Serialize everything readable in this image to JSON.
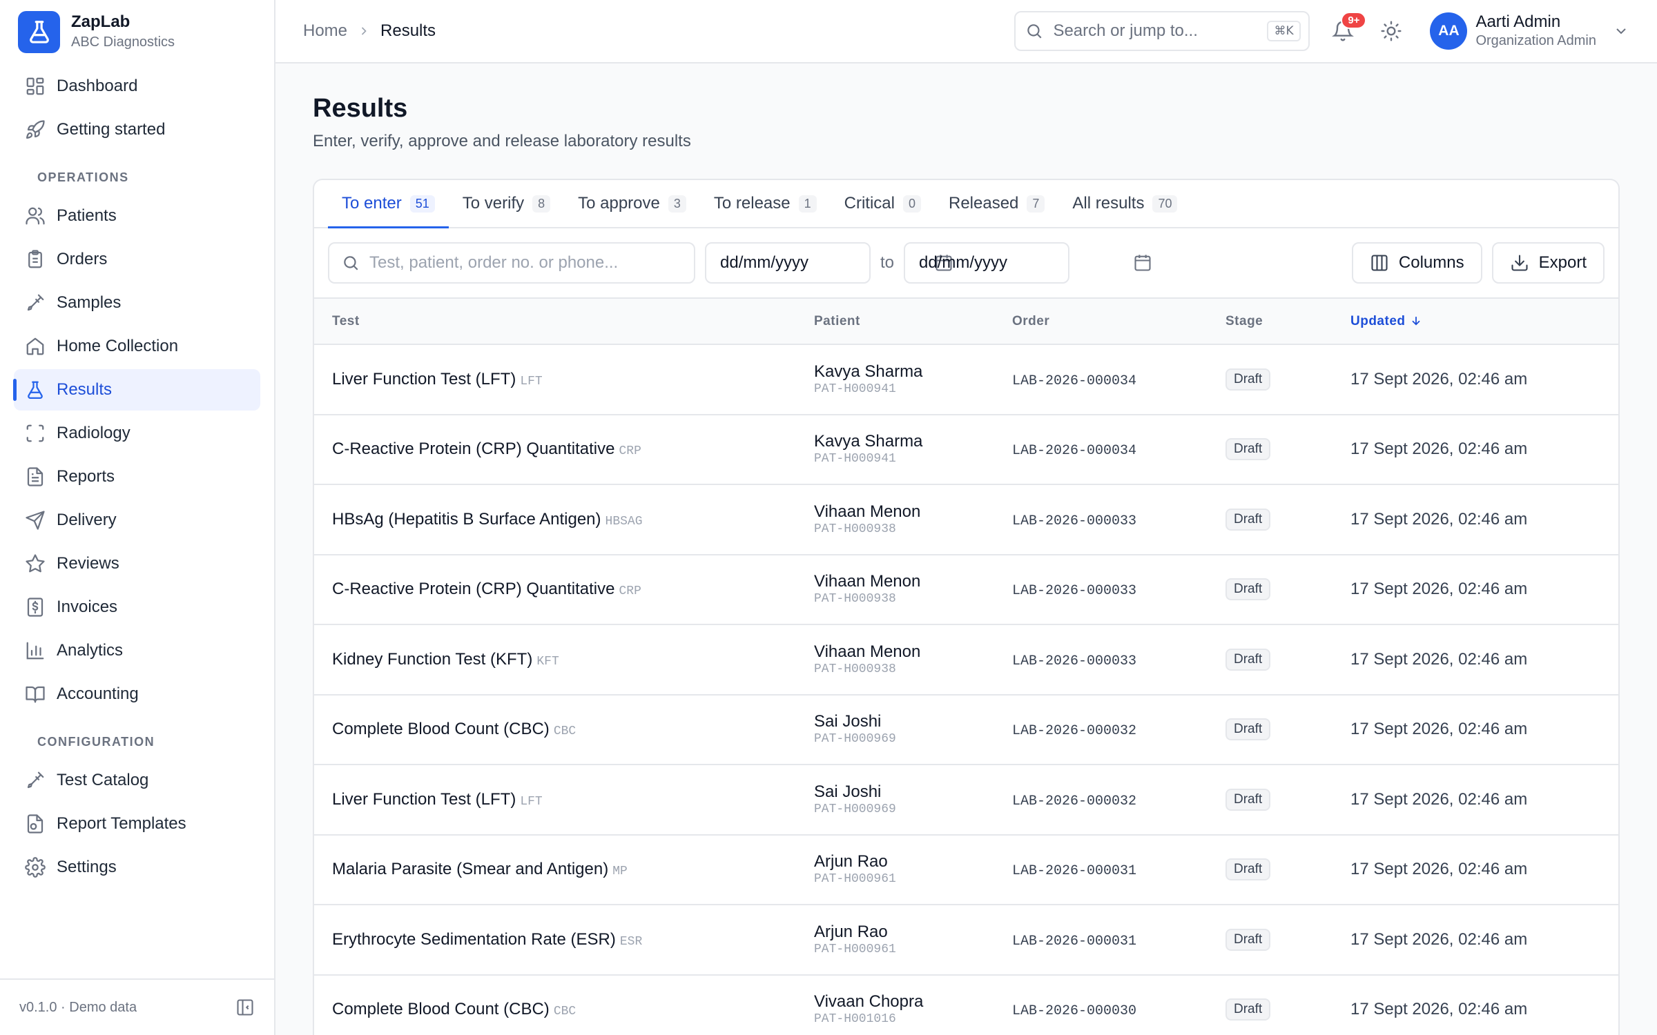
{
  "brand": {
    "name": "ZapLab",
    "org": "ABC Diagnostics"
  },
  "sidebar": {
    "top_items": [
      {
        "label": "Dashboard",
        "icon": "dashboard-icon"
      },
      {
        "label": "Getting started",
        "icon": "rocket-icon"
      }
    ],
    "operations_label": "OPERATIONS",
    "operations_items": [
      {
        "label": "Patients",
        "icon": "users-icon"
      },
      {
        "label": "Orders",
        "icon": "clipboard-icon"
      },
      {
        "label": "Samples",
        "icon": "pipette-icon"
      },
      {
        "label": "Home Collection",
        "icon": "home-icon"
      },
      {
        "label": "Results",
        "icon": "flask-icon",
        "active": true
      },
      {
        "label": "Radiology",
        "icon": "scan-icon"
      },
      {
        "label": "Reports",
        "icon": "file-text-icon"
      },
      {
        "label": "Delivery",
        "icon": "send-icon"
      },
      {
        "label": "Reviews",
        "icon": "star-icon"
      },
      {
        "label": "Invoices",
        "icon": "receipt-icon"
      },
      {
        "label": "Analytics",
        "icon": "bar-chart-icon"
      },
      {
        "label": "Accounting",
        "icon": "book-icon"
      }
    ],
    "configuration_label": "CONFIGURATION",
    "configuration_items": [
      {
        "label": "Test Catalog",
        "icon": "pipette-icon"
      },
      {
        "label": "Report Templates",
        "icon": "file-template-icon"
      },
      {
        "label": "Settings",
        "icon": "gear-icon"
      }
    ],
    "footer_version": "v0.1.0 · Demo data"
  },
  "topbar": {
    "breadcrumb_home": "Home",
    "breadcrumb_current": "Results",
    "search_placeholder": "Search or jump to...",
    "search_shortcut": "⌘K",
    "notification_count": "9+",
    "user_initials": "AA",
    "user_name": "Aarti Admin",
    "user_role": "Organization Admin"
  },
  "page": {
    "title": "Results",
    "subtitle": "Enter, verify, approve and release laboratory results"
  },
  "tabs": [
    {
      "label": "To enter",
      "count": "51",
      "active": true
    },
    {
      "label": "To verify",
      "count": "8"
    },
    {
      "label": "To approve",
      "count": "3"
    },
    {
      "label": "To release",
      "count": "1"
    },
    {
      "label": "Critical",
      "count": "0"
    },
    {
      "label": "Released",
      "count": "7"
    },
    {
      "label": "All results",
      "count": "70"
    }
  ],
  "filters": {
    "search_placeholder": "Test, patient, order no. or phone...",
    "date_from_placeholder": "dd/mm/yyyy",
    "date_to_placeholder": "dd/mm/yyyy",
    "to_label": "to",
    "columns_label": "Columns",
    "export_label": "Export"
  },
  "table": {
    "headers": {
      "test": "Test",
      "patient": "Patient",
      "order": "Order",
      "stage": "Stage",
      "updated": "Updated"
    },
    "rows": [
      {
        "test": "Liver Function Test (LFT)",
        "code": "LFT",
        "patient": "Kavya Sharma",
        "patient_id": "PAT-H000941",
        "order": "LAB-2026-000034",
        "stage": "Draft",
        "updated": "17 Sept 2026, 02:46 am"
      },
      {
        "test": "C-Reactive Protein (CRP) Quantitative",
        "code": "CRP",
        "patient": "Kavya Sharma",
        "patient_id": "PAT-H000941",
        "order": "LAB-2026-000034",
        "stage": "Draft",
        "updated": "17 Sept 2026, 02:46 am"
      },
      {
        "test": "HBsAg (Hepatitis B Surface Antigen)",
        "code": "HBSAG",
        "patient": "Vihaan Menon",
        "patient_id": "PAT-H000938",
        "order": "LAB-2026-000033",
        "stage": "Draft",
        "updated": "17 Sept 2026, 02:46 am"
      },
      {
        "test": "C-Reactive Protein (CRP) Quantitative",
        "code": "CRP",
        "patient": "Vihaan Menon",
        "patient_id": "PAT-H000938",
        "order": "LAB-2026-000033",
        "stage": "Draft",
        "updated": "17 Sept 2026, 02:46 am"
      },
      {
        "test": "Kidney Function Test (KFT)",
        "code": "KFT",
        "patient": "Vihaan Menon",
        "patient_id": "PAT-H000938",
        "order": "LAB-2026-000033",
        "stage": "Draft",
        "updated": "17 Sept 2026, 02:46 am"
      },
      {
        "test": "Complete Blood Count (CBC)",
        "code": "CBC",
        "patient": "Sai Joshi",
        "patient_id": "PAT-H000969",
        "order": "LAB-2026-000032",
        "stage": "Draft",
        "updated": "17 Sept 2026, 02:46 am"
      },
      {
        "test": "Liver Function Test (LFT)",
        "code": "LFT",
        "patient": "Sai Joshi",
        "patient_id": "PAT-H000969",
        "order": "LAB-2026-000032",
        "stage": "Draft",
        "updated": "17 Sept 2026, 02:46 am"
      },
      {
        "test": "Malaria Parasite (Smear and Antigen)",
        "code": "MP",
        "patient": "Arjun Rao",
        "patient_id": "PAT-H000961",
        "order": "LAB-2026-000031",
        "stage": "Draft",
        "updated": "17 Sept 2026, 02:46 am"
      },
      {
        "test": "Erythrocyte Sedimentation Rate (ESR)",
        "code": "ESR",
        "patient": "Arjun Rao",
        "patient_id": "PAT-H000961",
        "order": "LAB-2026-000031",
        "stage": "Draft",
        "updated": "17 Sept 2026, 02:46 am"
      },
      {
        "test": "Complete Blood Count (CBC)",
        "code": "CBC",
        "patient": "Vivaan Chopra",
        "patient_id": "PAT-H001016",
        "order": "LAB-2026-000030",
        "stage": "Draft",
        "updated": "17 Sept 2026, 02:46 am"
      }
    ]
  },
  "colors": {
    "accent": "#2563eb",
    "notification": "#ef4444"
  }
}
